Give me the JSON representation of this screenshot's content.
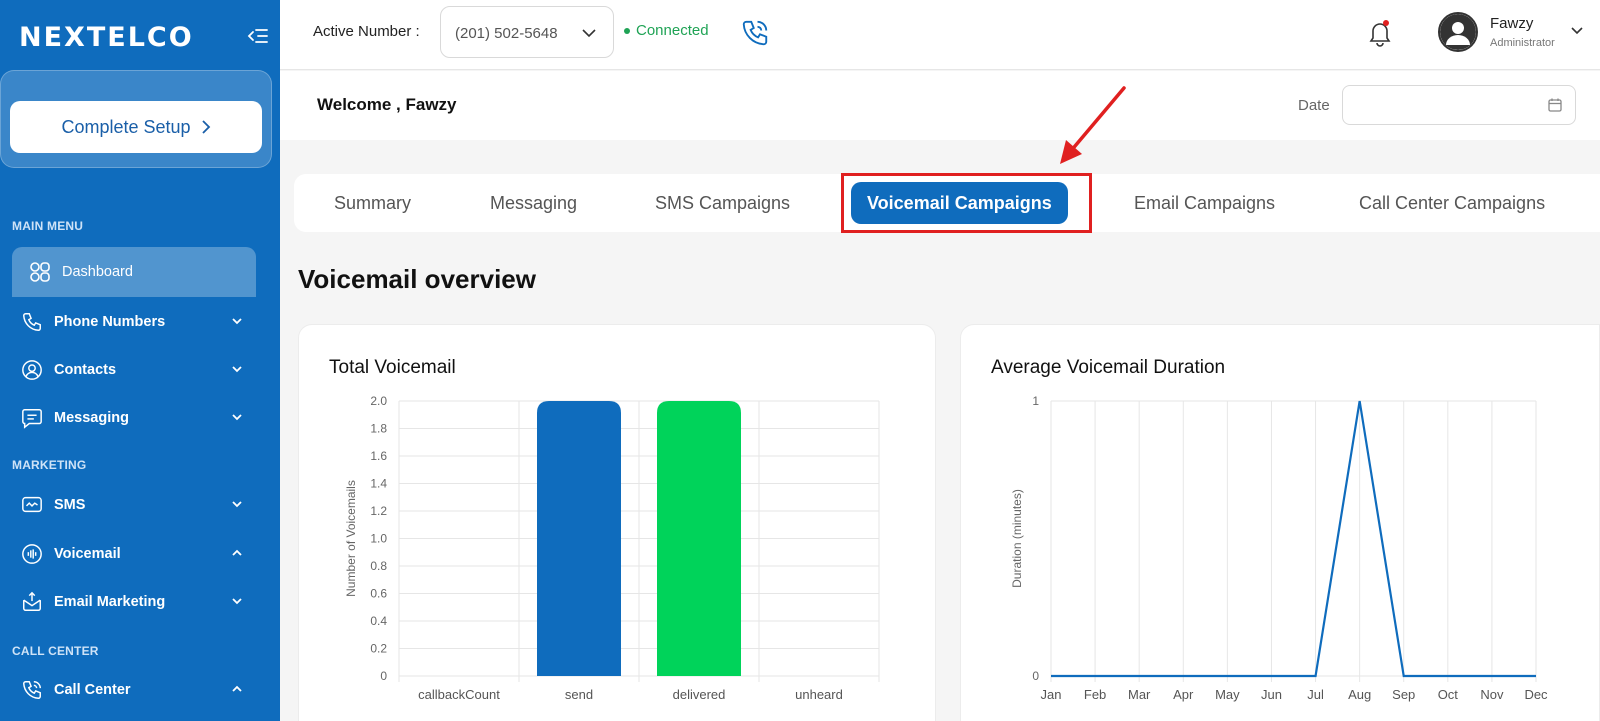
{
  "brand": {
    "logo_text": "NEXTELCO"
  },
  "sidebar": {
    "setup_label": "Complete Setup",
    "sections": {
      "main_menu": "MAIN MENU",
      "marketing": "MARKETING",
      "call_center": "CALL CENTER"
    },
    "items": [
      {
        "label": "Dashboard",
        "icon": "dashboard-grid-icon"
      },
      {
        "label": "Phone Numbers",
        "icon": "phone-icon"
      },
      {
        "label": "Contacts",
        "icon": "contacts-icon"
      },
      {
        "label": "Messaging",
        "icon": "message-icon"
      },
      {
        "label": "SMS",
        "icon": "sms-icon"
      },
      {
        "label": "Voicemail",
        "icon": "voicemail-icon"
      },
      {
        "label": "Email Marketing",
        "icon": "email-marketing-icon"
      },
      {
        "label": "Call Center",
        "icon": "call-center-icon"
      }
    ]
  },
  "topbar": {
    "active_number_label": "Active Number :",
    "active_number_value": "(201) 502-5648",
    "status_text": "Connected",
    "user_name": "Fawzy",
    "user_role": "Administrator"
  },
  "welcome": {
    "text": "Welcome , Fawzy",
    "date_label": "Date",
    "date_value": ""
  },
  "tabs": [
    {
      "label": "Summary"
    },
    {
      "label": "Messaging"
    },
    {
      "label": "SMS Campaigns"
    },
    {
      "label": "Voicemail Campaigns",
      "active": true
    },
    {
      "label": "Email Campaigns"
    },
    {
      "label": "Call Center Campaigns"
    }
  ],
  "overview_title": "Voicemail overview",
  "colors": {
    "primary": "#0f6cbd",
    "delivered": "#00d35a",
    "connected": "#1fa355",
    "highlight": "#e02020"
  },
  "chart_data": [
    {
      "type": "bar",
      "title": "Total Voicemail",
      "categories": [
        "callbackCount",
        "send",
        "delivered",
        "unheard"
      ],
      "values": [
        0,
        2,
        2,
        0
      ],
      "colors": [
        "#0f6cbd",
        "#0f6cbd",
        "#00d35a",
        "#0f6cbd"
      ],
      "ylabel": "Number of Voicemails",
      "yticks": [
        "0",
        "0.2",
        "0.4",
        "0.6",
        "0.8",
        "1.0",
        "1.2",
        "1.4",
        "1.6",
        "1.8",
        "2.0"
      ],
      "ylim": [
        0,
        2
      ],
      "grid": true
    },
    {
      "type": "line",
      "title": "Average Voicemail Duration",
      "categories": [
        "Jan",
        "Feb",
        "Mar",
        "Apr",
        "May",
        "Jun",
        "Jul",
        "Aug",
        "Sep",
        "Oct",
        "Nov",
        "Dec"
      ],
      "values": [
        0,
        0,
        0,
        0,
        0,
        0,
        0,
        1,
        0,
        0,
        0,
        0
      ],
      "ylabel": "Duration (minutes)",
      "yticks": [
        "0",
        "1"
      ],
      "ylim": [
        0,
        1
      ],
      "grid": true
    }
  ]
}
